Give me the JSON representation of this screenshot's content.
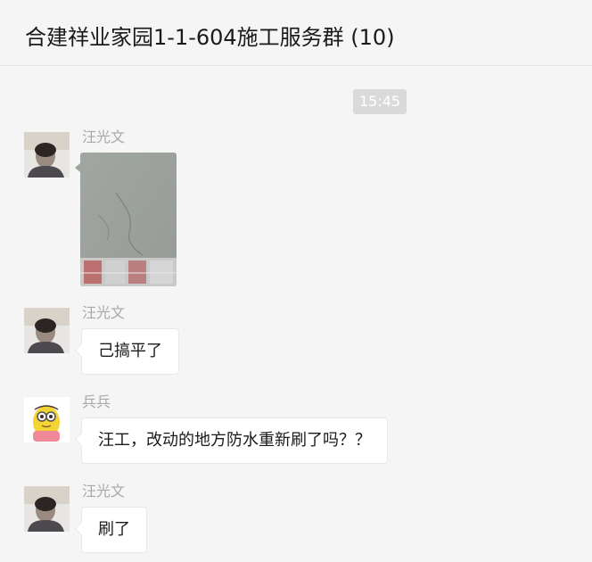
{
  "header": {
    "title": "合建祥业家园1-1-604施工服务群 (10)"
  },
  "time_separator": "15:45",
  "messages": [
    {
      "sender": "汪光文",
      "type": "image",
      "avatar": "person-photo-avatar"
    },
    {
      "sender": "汪光文",
      "type": "text",
      "text": "己搞平了",
      "avatar": "person-photo-avatar"
    },
    {
      "sender": "兵兵",
      "type": "text",
      "text": "汪工，改动的地方防水重新刷了吗？？",
      "avatar": "cartoon-minion-avatar"
    },
    {
      "sender": "汪光文",
      "type": "text",
      "text": "刷了",
      "avatar": "person-photo-avatar"
    }
  ],
  "colors": {
    "background": "#f5f5f5",
    "bubble": "#ffffff",
    "sender_name": "#a8a8a8",
    "time_badge": "#dadada"
  }
}
